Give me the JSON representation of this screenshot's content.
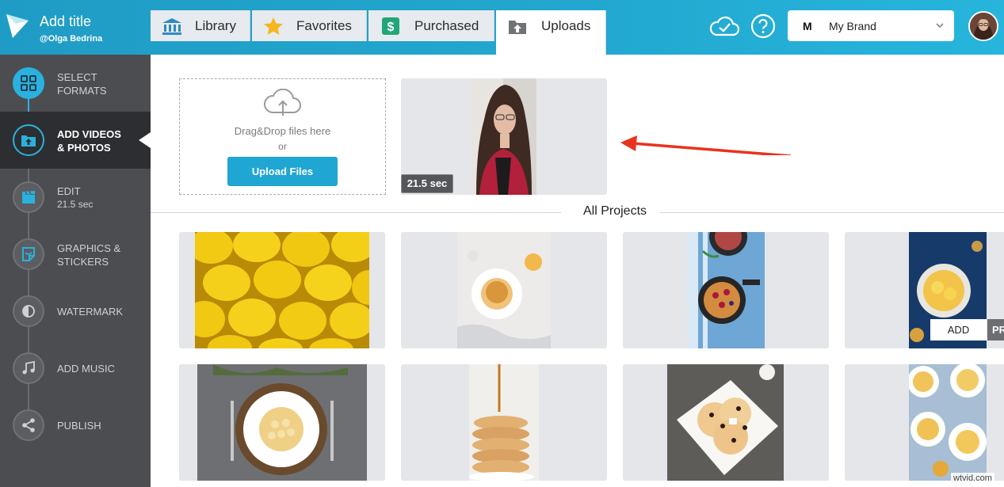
{
  "header": {
    "title": "Add title",
    "user": "@Olga Bedrina"
  },
  "tabs": [
    {
      "label": "Library",
      "icon": "library-icon"
    },
    {
      "label": "Favorites",
      "icon": "star-icon"
    },
    {
      "label": "Purchased",
      "icon": "dollar-icon"
    },
    {
      "label": "Uploads",
      "icon": "upload-folder-icon",
      "active": true
    }
  ],
  "brand": {
    "mark": "M",
    "name": "My Brand"
  },
  "sidebar": {
    "steps": [
      {
        "label": "Select formats",
        "status": "done"
      },
      {
        "label": "Add videos & photos",
        "status": "active"
      },
      {
        "label": "Edit",
        "sub": "21.5 sec",
        "status": "pending"
      },
      {
        "label": "Graphics & stickers",
        "status": "pending"
      },
      {
        "label": "Watermark",
        "status": "pending"
      },
      {
        "label": "Add music",
        "status": "pending"
      },
      {
        "label": "Publish",
        "status": "pending"
      }
    ]
  },
  "upload": {
    "drop_text": "Drag&Drop files here",
    "or_text": "or",
    "button_label": "Upload Files",
    "uploaded_duration": "21.5 sec"
  },
  "projects": {
    "title": "All Projects",
    "add_label": "ADD",
    "preview_label_partial": "PR",
    "items": [
      "Lemons",
      "Pancakes with syrup",
      "Skillet pancake with berries",
      "Crepes with oranges",
      "Banana pancakes plate",
      "Pancake stack",
      "Pancakes with raisins",
      "Crepes on blue table"
    ]
  },
  "colors": {
    "accent": "#22a7cf",
    "sidebar": "#4c4d51",
    "step_done": "#29b2df",
    "arrow": "#e8341c"
  },
  "watermark": "wtvid.com"
}
